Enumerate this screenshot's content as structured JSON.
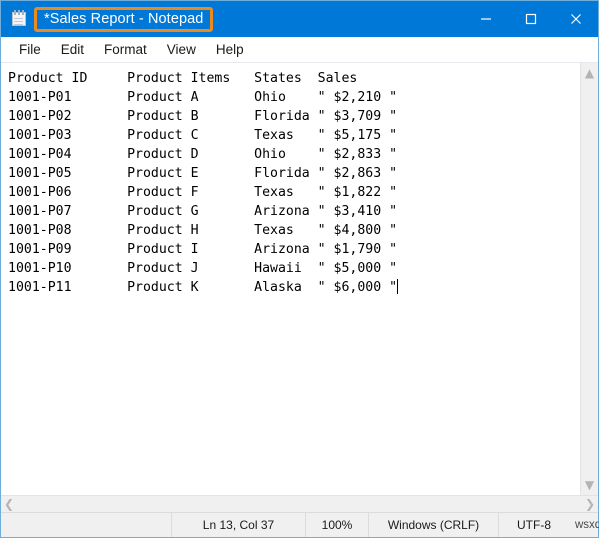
{
  "window": {
    "title": "*Sales Report - Notepad",
    "icon": "notepad-icon",
    "highlight_color": "#e98b20",
    "titlebar_color": "#0078d7",
    "controls": {
      "minimize": "minimize-button",
      "maximize": "maximize-button",
      "close": "close-button"
    }
  },
  "menu": {
    "items": [
      {
        "label": "File"
      },
      {
        "label": "Edit"
      },
      {
        "label": "Format"
      },
      {
        "label": "View"
      },
      {
        "label": "Help"
      }
    ]
  },
  "document": {
    "columns": [
      "Product ID",
      "Product Items",
      "States",
      "Sales"
    ],
    "header_line": "Product ID     Product Items   States  Sales",
    "rows": [
      {
        "id": "1001-P01",
        "item": "Product A",
        "state": "Ohio",
        "sales": "\" $2,210 \""
      },
      {
        "id": "1001-P02",
        "item": "Product B",
        "state": "Florida",
        "sales": "\" $3,709 \""
      },
      {
        "id": "1001-P03",
        "item": "Product C",
        "state": "Texas",
        "sales": "\" $5,175 \""
      },
      {
        "id": "1001-P04",
        "item": "Product D",
        "state": "Ohio",
        "sales": "\" $2,833 \""
      },
      {
        "id": "1001-P05",
        "item": "Product E",
        "state": "Florida",
        "sales": "\" $2,863 \""
      },
      {
        "id": "1001-P06",
        "item": "Product F",
        "state": "Texas",
        "sales": "\" $1,822 \""
      },
      {
        "id": "1001-P07",
        "item": "Product G",
        "state": "Arizona",
        "sales": "\" $3,410 \""
      },
      {
        "id": "1001-P08",
        "item": "Product H",
        "state": "Texas",
        "sales": "\" $4,800 \""
      },
      {
        "id": "1001-P09",
        "item": "Product I",
        "state": "Arizona",
        "sales": "\" $1,790 \""
      },
      {
        "id": "1001-P10",
        "item": "Product J",
        "state": "Hawaii",
        "sales": "\" $5,000 \""
      },
      {
        "id": "1001-P11",
        "item": "Product K",
        "state": "Alaska",
        "sales": "\" $6,000 \""
      }
    ],
    "text": "Product ID     Product Items   States  Sales\n1001-P01       Product A       Ohio    \" $2,210 \"\n1001-P02       Product B       Florida \" $3,709 \"\n1001-P03       Product C       Texas   \" $5,175 \"\n1001-P04       Product D       Ohio    \" $2,833 \"\n1001-P05       Product E       Florida \" $2,863 \"\n1001-P06       Product F       Texas   \" $1,822 \"\n1001-P07       Product G       Arizona \" $3,410 \"\n1001-P08       Product H       Texas   \" $4,800 \"\n1001-P09       Product I       Arizona \" $1,790 \"\n1001-P10       Product J       Hawaii  \" $5,000 \"\n1001-P11       Product K       Alaska  \" $6,000 \""
  },
  "statusbar": {
    "position": "Ln 13, Col 37",
    "zoom": "100%",
    "line_ending": "Windows (CRLF)",
    "encoding": "UTF-8",
    "watermark": "wsxdn.com"
  },
  "scrollbars": {
    "vertical_up": "scroll-up-arrow",
    "vertical_down": "scroll-down-arrow",
    "horizontal_left": "scroll-left-arrow",
    "horizontal_right": "scroll-right-arrow"
  }
}
